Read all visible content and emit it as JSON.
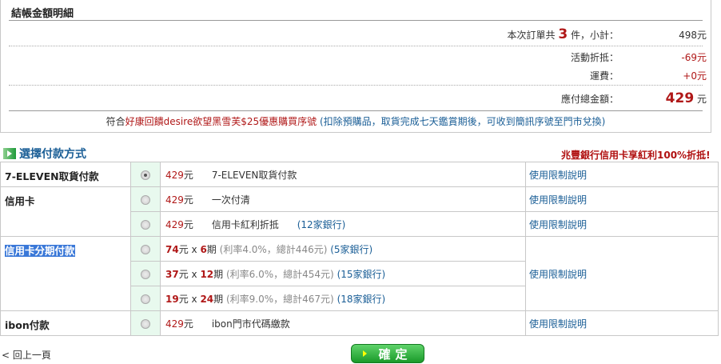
{
  "summary": {
    "title": "結帳金額明細",
    "subtotal_prefix": "本次訂單共",
    "item_count": "3",
    "subtotal_suffix": "件，小計：",
    "subtotal": "498元",
    "discount_label": "活動折抵：",
    "discount": "-69元",
    "shipping_label": "運費：",
    "shipping": "+0元",
    "total_label": "應付總金額：",
    "total": "429",
    "total_unit": "元"
  },
  "promo": {
    "prefix": "符合",
    "highlight": "好康回饋desire欲望黑雪芙$25優惠購買序號",
    "note": "(扣除預購品，取貨完成七天鑑賞期後，可收到簡訊序號至門市兌換)"
  },
  "payment": {
    "title": "選擇付款方式",
    "bank_promo": "兆豐銀行信用卡享紅利100%折抵!",
    "methods": [
      {
        "name": "7-ELEVEN取貨付款",
        "amount": "429",
        "unit": "元",
        "desc": "7-ELEVEN取貨付款",
        "link": "使用限制說明"
      },
      {
        "name": "信用卡",
        "amount": "429",
        "unit": "元",
        "desc": "一次付清",
        "link": "使用限制說明"
      },
      {
        "amount": "429",
        "unit": "元",
        "desc": "信用卡紅利折抵",
        "banks": "(12家銀行)",
        "link": "使用限制說明"
      },
      {
        "name": "信用卡分期付款",
        "amount": "74",
        "unit": "元 x ",
        "periods": "6",
        "period_unit": "期",
        "rate": "(利率4.0%，總計446元)",
        "banks": "(5家銀行)",
        "link": "使用限制說明"
      },
      {
        "amount": "37",
        "unit": "元 x ",
        "periods": "12",
        "period_unit": "期",
        "rate": "(利率6.0%，總計454元)",
        "banks": "(15家銀行)"
      },
      {
        "amount": "19",
        "unit": "元 x ",
        "periods": "24",
        "period_unit": "期",
        "rate": "(利率9.0%，總計467元)",
        "banks": "(18家銀行)"
      },
      {
        "name": "ibon付款",
        "amount": "429",
        "unit": "元",
        "desc": "ibon門市代碼繳款",
        "link": "使用限制說明"
      }
    ]
  },
  "footer": {
    "back": "< 回上一頁",
    "confirm": "確定"
  }
}
